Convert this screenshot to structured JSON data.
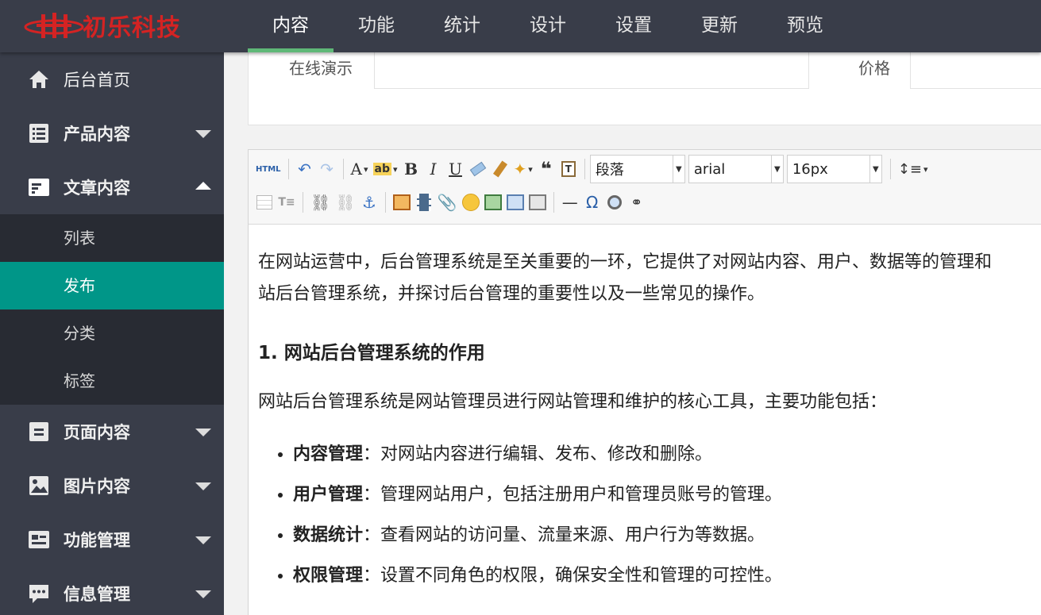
{
  "header": {
    "logo_text": "初乐科技",
    "nav": [
      {
        "label": "内容",
        "active": true
      },
      {
        "label": "功能"
      },
      {
        "label": "统计"
      },
      {
        "label": "设计"
      },
      {
        "label": "设置"
      },
      {
        "label": "更新"
      },
      {
        "label": "预览"
      }
    ]
  },
  "sidebar": {
    "items": [
      {
        "label": "后台首页",
        "icon": "home-icon"
      },
      {
        "label": "产品内容",
        "icon": "list-icon"
      },
      {
        "label": "文章内容",
        "icon": "article-icon",
        "expanded": true,
        "children": [
          {
            "label": "列表"
          },
          {
            "label": "发布",
            "active": true
          },
          {
            "label": "分类"
          },
          {
            "label": "标签"
          }
        ]
      },
      {
        "label": "页面内容",
        "icon": "page-icon"
      },
      {
        "label": "图片内容",
        "icon": "image-icon"
      },
      {
        "label": "功能管理",
        "icon": "function-icon"
      },
      {
        "label": "信息管理",
        "icon": "message-icon"
      }
    ]
  },
  "form": {
    "demo_label": "在线演示",
    "price_label": "价格"
  },
  "toolbar": {
    "html_label": "HTML",
    "paragraph": "段落",
    "font_family": "arial",
    "font_size": "16px"
  },
  "content": {
    "intro": "在网站运营中，后台管理系统是至关重要的一环，它提供了对网站内容、用户、数据等的管理和",
    "intro_cont": "站后台管理系统，并探讨后台管理的重要性以及一些常见的操作。",
    "heading": "1. 网站后台管理系统的作用",
    "para": "网站后台管理系统是网站管理员进行网站管理和维护的核心工具，主要功能包括：",
    "list": [
      {
        "term": "内容管理",
        "desc": "：对网站内容进行编辑、发布、修改和删除。"
      },
      {
        "term": "用户管理",
        "desc": "：管理网站用户，包括注册用户和管理员账号的管理。"
      },
      {
        "term": "数据统计",
        "desc": "：查看网站的访问量、流量来源、用户行为等数据。"
      },
      {
        "term": "权限管理",
        "desc": "：设置不同角色的权限，确保安全性和管理的可控性。"
      }
    ]
  },
  "colors": {
    "topbar": "#393d49",
    "sidebar": "#393d49",
    "submenu": "#282b33",
    "active_sub": "#009688",
    "nav_indicator": "#5fb878",
    "logo": "#d42323"
  }
}
